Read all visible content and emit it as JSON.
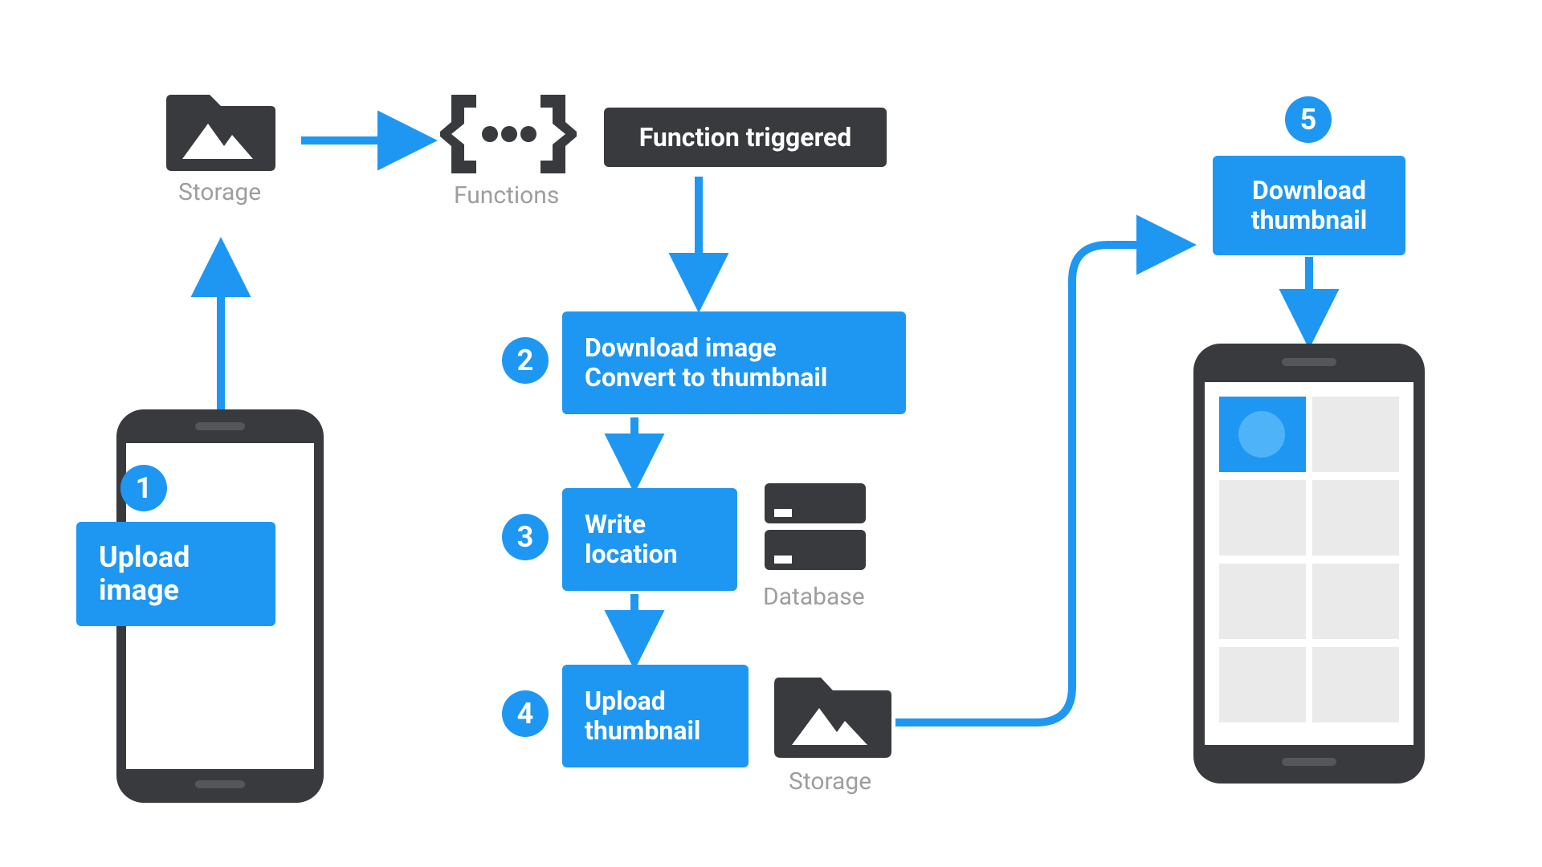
{
  "labels": {
    "storage_top": "Storage",
    "functions": "Functions",
    "function_triggered": "Function triggered",
    "upload_image": "Upload image",
    "download_convert_l1": "Download image",
    "download_convert_l2": "Convert to thumbnail",
    "write_location_l1": "Write",
    "write_location_l2": "location",
    "database": "Database",
    "upload_thumbnail_l1": "Upload",
    "upload_thumbnail_l2": "thumbnail",
    "storage_bottom": "Storage",
    "download_thumb_l1": "Download",
    "download_thumb_l2": "thumbnail"
  },
  "badges": {
    "b1": "1",
    "b2": "2",
    "b3": "3",
    "b4": "4",
    "b5": "5"
  },
  "colors": {
    "accent": "#1E97F3",
    "dark": "#393A3D",
    "muted": "#9E9E9E"
  }
}
